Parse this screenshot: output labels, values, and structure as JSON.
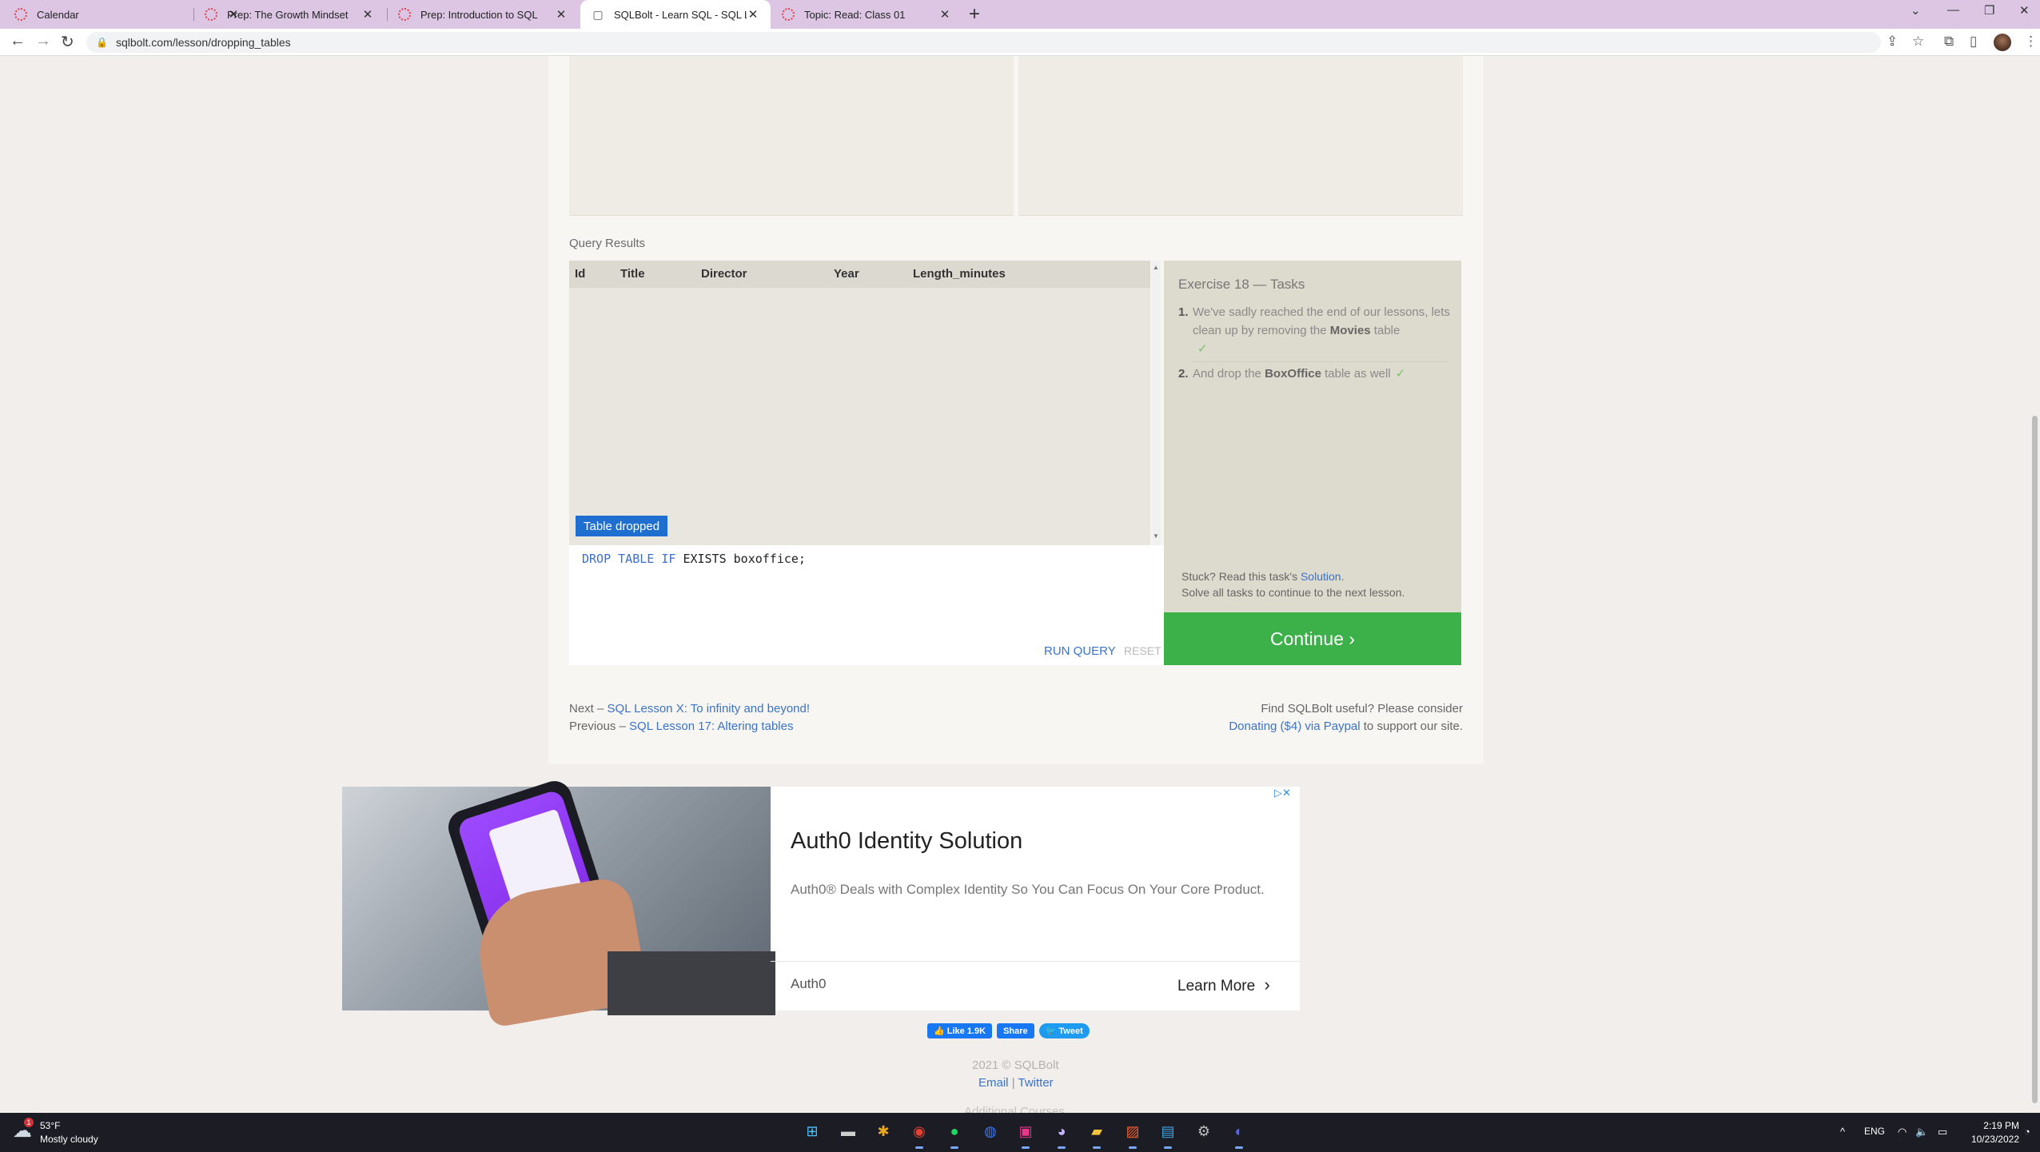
{
  "browser": {
    "tabs": [
      {
        "title": "Calendar",
        "active": false
      },
      {
        "title": "Prep: The Growth Mindset",
        "active": false
      },
      {
        "title": "Prep: Introduction to SQL",
        "active": false
      },
      {
        "title": "SQLBolt - Learn SQL - SQL Lesso",
        "active": true
      },
      {
        "title": "Topic: Read: Class 01",
        "active": false
      }
    ],
    "tab_close": "✕",
    "new_tab": "+",
    "url": "sqlbolt.com/lesson/dropping_tables",
    "icons": {
      "back": "←",
      "forward": "→",
      "reload": "↻",
      "lock": "🔒",
      "share": "⇪",
      "star": "☆",
      "extensions": "⧉",
      "sidebar": "▯",
      "menu": "⋮",
      "minimize": "—",
      "restore": "❐",
      "close": "✕",
      "tablist": "⌄"
    }
  },
  "query_results": {
    "label": "Query Results",
    "columns": [
      "Id",
      "Title",
      "Director",
      "Year",
      "Length_minutes"
    ],
    "rows": [],
    "status": "Table dropped"
  },
  "editor": {
    "query_parts": [
      "DROP",
      "TABLE",
      "IF",
      "EXISTS boxoffice;"
    ],
    "run_label": "RUN QUERY",
    "reset_label": "RESET"
  },
  "tasks": {
    "title": "Exercise 18 — Tasks",
    "items": [
      {
        "num": "1.",
        "pre": "We've sadly reached the end of our lessons, lets clean up by removing the ",
        "bold": "Movies",
        "post": " table",
        "check": "✓"
      },
      {
        "num": "2.",
        "pre": "And drop the ",
        "bold": "BoxOffice",
        "post": " table as well",
        "check": "✓"
      }
    ],
    "stuck_text": "Stuck? Read this task's ",
    "solution_link": "Solution",
    "stuck_text_end": ".",
    "solve_all": "Solve all tasks to continue to the next lesson.",
    "continue_label": "Continue ›"
  },
  "footer": {
    "next_prefix": "Next – ",
    "next_link": "SQL Lesson X: To infinity and beyond!",
    "prev_prefix": "Previous – ",
    "prev_link": "SQL Lesson 17: Altering tables",
    "useful_text": "Find SQLBolt useful? Please consider",
    "donate_link": "Donating ($4) via Paypal",
    "support_text": " to support our site."
  },
  "ad": {
    "headline": "Auth0 Identity Solution",
    "description": "Auth0® Deals with Complex Identity So You Can Focus On Your Core Product.",
    "brand": "Auth0",
    "cta": "Learn More",
    "cta_icon": "›",
    "choices_icon": "▷✕"
  },
  "social": {
    "like": "👍 Like 1.9K",
    "share": "Share",
    "tweet": "🐦 Tweet"
  },
  "site_footer": {
    "copyright": "2021 © SQLBolt",
    "email": "Email",
    "separator": "|",
    "twitter": "Twitter",
    "more": "Additional Courses"
  },
  "taskbar": {
    "weather_temp": "53°F",
    "weather_desc": "Mostly cloudy",
    "weather_badge": "1",
    "weather_icon": "☁",
    "apps": [
      {
        "name": "start-icon",
        "glyph": "⊞",
        "color": "#4cc2ff"
      },
      {
        "name": "file-explorer-icon",
        "glyph": "▬",
        "color": "#cfcfcf"
      },
      {
        "name": "slack-icon",
        "glyph": "✱",
        "color": "#e9a820"
      },
      {
        "name": "chrome-icon",
        "glyph": "◉",
        "color": "#e34133"
      },
      {
        "name": "spotify-icon",
        "glyph": "●",
        "color": "#1ed760"
      },
      {
        "name": "signal-icon",
        "glyph": "◍",
        "color": "#3a76f0"
      },
      {
        "name": "intellij-icon",
        "glyph": "▣",
        "color": "#e8388a"
      },
      {
        "name": "github-icon",
        "glyph": "◕",
        "color": "#c6b4ff"
      },
      {
        "name": "folder-icon",
        "glyph": "▰",
        "color": "#f3c43c"
      },
      {
        "name": "office-icon",
        "glyph": "▨",
        "color": "#eb5c2e"
      },
      {
        "name": "photos-icon",
        "glyph": "▤",
        "color": "#3fa6e6"
      },
      {
        "name": "settings-icon",
        "glyph": "⚙",
        "color": "#bfbfbf"
      },
      {
        "name": "discord-icon",
        "glyph": "◐",
        "color": "#5865f2"
      }
    ],
    "tray_chevron": "^",
    "lang": "ENG",
    "wifi": "◠",
    "volume": "🔈",
    "battery": "▭",
    "time": "2:19 PM",
    "date": "10/23/2022",
    "notification": "◔"
  }
}
